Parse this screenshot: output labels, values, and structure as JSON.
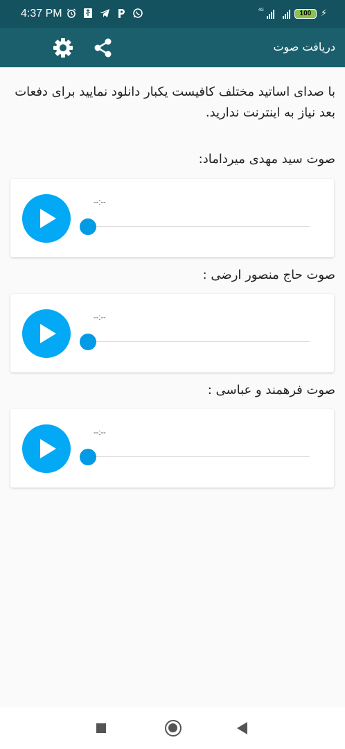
{
  "status_bar": {
    "time": "4:37 PM",
    "network_label": "4G",
    "battery": "100",
    "icons": [
      "alarm-icon",
      "usb-icon",
      "telegram-icon",
      "p-app-icon",
      "whatsapp-icon"
    ]
  },
  "app_bar": {
    "title": "دریافت صوت",
    "actions": [
      "settings-icon",
      "share-icon"
    ]
  },
  "intro_text": "با صدای اساتید مختلف کافیست یکبار دانلود نمایید برای دفعات بعد نیاز به اینترنت ندارید.",
  "audio_sections": [
    {
      "title": "صوت سید مهدی میرداماد:",
      "time": "--:--"
    },
    {
      "title": "صوت حاج منصور ارضی :",
      "time": "--:--"
    },
    {
      "title": "صوت فرهمند و عباسی :",
      "time": "--:--"
    }
  ],
  "colors": {
    "status_bar": "#15525f",
    "app_bar": "#1b5f6c",
    "play_button": "#03a9f4",
    "seek_thumb": "#039be5",
    "background": "#fafafa"
  }
}
